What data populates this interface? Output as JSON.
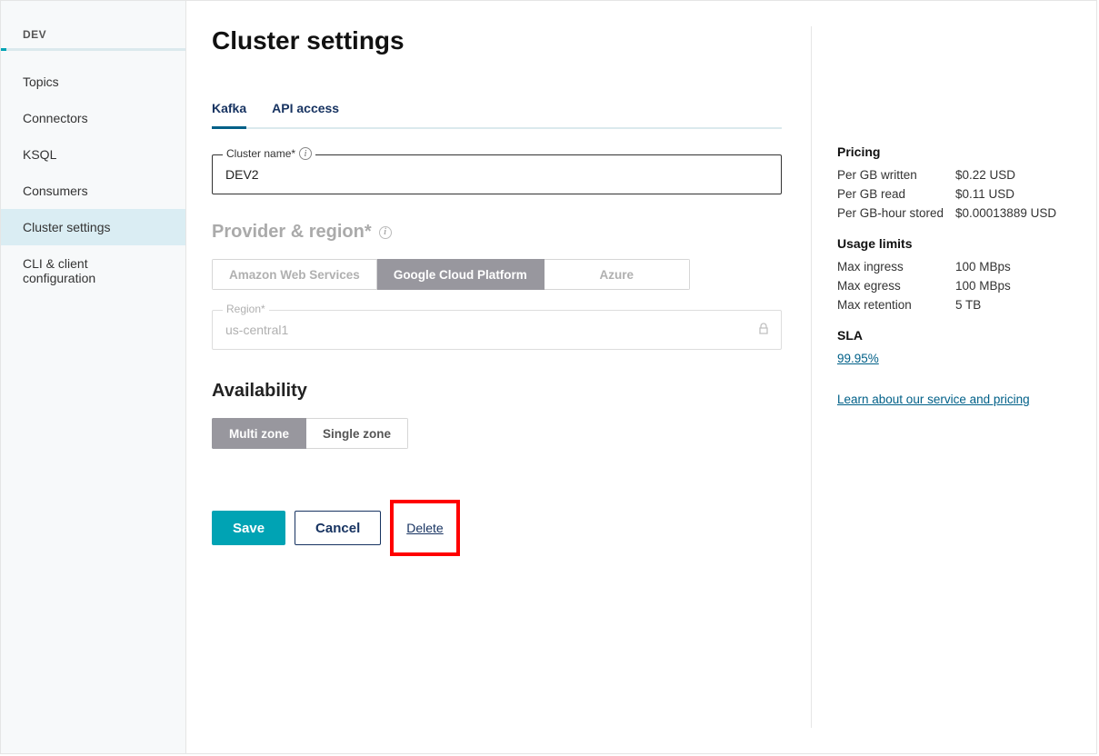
{
  "sidebar": {
    "header": "DEV",
    "items": [
      {
        "label": "Topics"
      },
      {
        "label": "Connectors"
      },
      {
        "label": "KSQL"
      },
      {
        "label": "Consumers"
      },
      {
        "label": "Cluster settings"
      },
      {
        "label": "CLI & client configuration"
      }
    ]
  },
  "page": {
    "title": "Cluster settings"
  },
  "tabs": {
    "kafka": "Kafka",
    "api": "API access"
  },
  "clusterName": {
    "label": "Cluster name*",
    "value": "DEV2"
  },
  "providerSection": {
    "heading": "Provider & region*"
  },
  "providers": {
    "aws": "Amazon Web Services",
    "gcp": "Google Cloud Platform",
    "azure": "Azure"
  },
  "region": {
    "label": "Region*",
    "value": "us-central1"
  },
  "availability": {
    "heading": "Availability",
    "multi": "Multi zone",
    "single": "Single zone"
  },
  "actions": {
    "save": "Save",
    "cancel": "Cancel",
    "delete": "Delete"
  },
  "pricing": {
    "heading": "Pricing",
    "rows": [
      {
        "k": "Per GB written",
        "v": "$0.22 USD"
      },
      {
        "k": "Per GB read",
        "v": "$0.11 USD"
      },
      {
        "k": "Per GB-hour stored",
        "v": "$0.00013889 USD"
      }
    ]
  },
  "usage": {
    "heading": "Usage limits",
    "rows": [
      {
        "k": "Max ingress",
        "v": "100 MBps"
      },
      {
        "k": "Max egress",
        "v": "100 MBps"
      },
      {
        "k": "Max retention",
        "v": "5 TB"
      }
    ]
  },
  "sla": {
    "heading": "SLA",
    "value": "99.95%"
  },
  "learnLink": "Learn about our service and pricing"
}
